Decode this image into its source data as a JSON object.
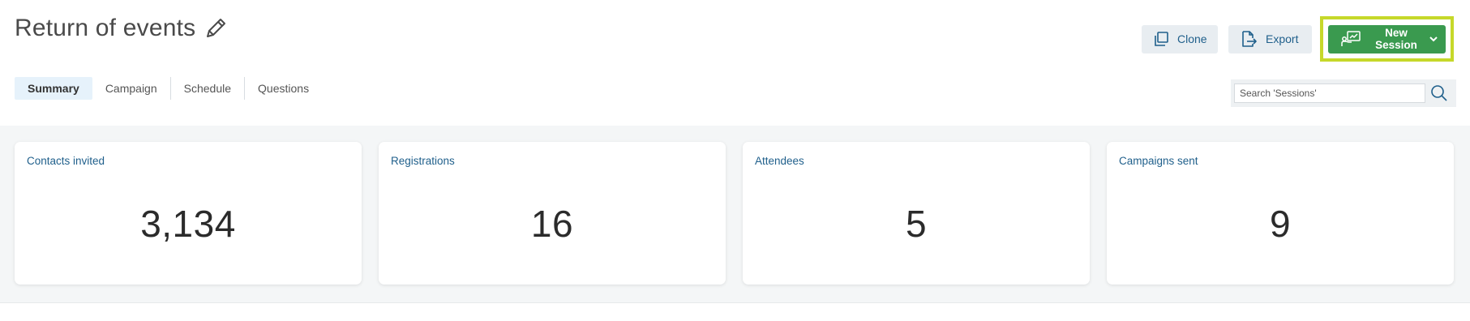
{
  "header": {
    "title": "Return of events",
    "actions": {
      "clone_label": "Clone",
      "export_label": "Export",
      "new_session_label": "New Session"
    }
  },
  "tabs": [
    {
      "label": "Summary",
      "active": true
    },
    {
      "label": "Campaign",
      "active": false
    },
    {
      "label": "Schedule",
      "active": false
    },
    {
      "label": "Questions",
      "active": false
    }
  ],
  "search": {
    "placeholder": "Search 'Sessions'"
  },
  "stats": [
    {
      "label": "Contacts invited",
      "value": "3,134"
    },
    {
      "label": "Registrations",
      "value": "16"
    },
    {
      "label": "Attendees",
      "value": "5"
    },
    {
      "label": "Campaigns sent",
      "value": "9"
    }
  ],
  "colors": {
    "accent_blue": "#1f5f8b",
    "primary_green": "#3a9a4f",
    "highlight_border": "#c6d82a",
    "active_tab_bg": "#e6f2fb"
  },
  "icons": {
    "edit": "pencil-icon",
    "clone": "copy-icon",
    "export": "export-file-icon",
    "new_session": "presentation-icon",
    "dropdown": "chevron-down-icon",
    "search": "search-icon"
  }
}
